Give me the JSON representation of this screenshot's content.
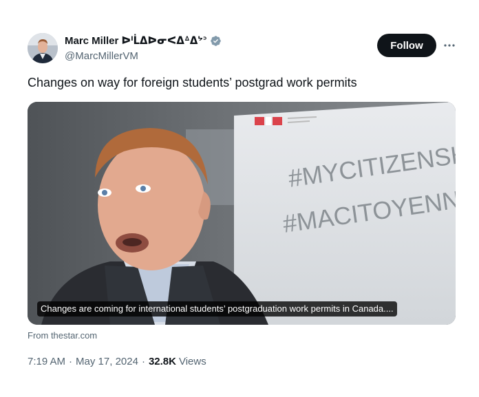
{
  "author": {
    "display_name": "Marc Miller ᐅᑊᒫᐃᐅᓂᐸᐃᐞᐃᔾᐣ",
    "handle": "@MarcMillerVM",
    "verified": true,
    "avatar_icon": "avatar-photo"
  },
  "actions": {
    "follow_label": "Follow",
    "more_icon": "more-horizontal-icon"
  },
  "tweet": {
    "text": "Changes on way for foreign students’ postgrad work permits"
  },
  "card": {
    "caption": "Changes are coming for international students’ postgraduation work permits in Canada....",
    "source": "From thestar.com",
    "banner_line1": "#MYCITIZENSHIP",
    "banner_line2": "#MACITOYENNETÉ"
  },
  "meta": {
    "time": "7:19 AM",
    "date": "May 17, 2024",
    "views_count": "32.8K",
    "views_label": "Views",
    "separator": "·"
  },
  "colors": {
    "text": "#0f1419",
    "secondary": "#536471",
    "verified": "#829aab",
    "button": "#0f1419"
  }
}
